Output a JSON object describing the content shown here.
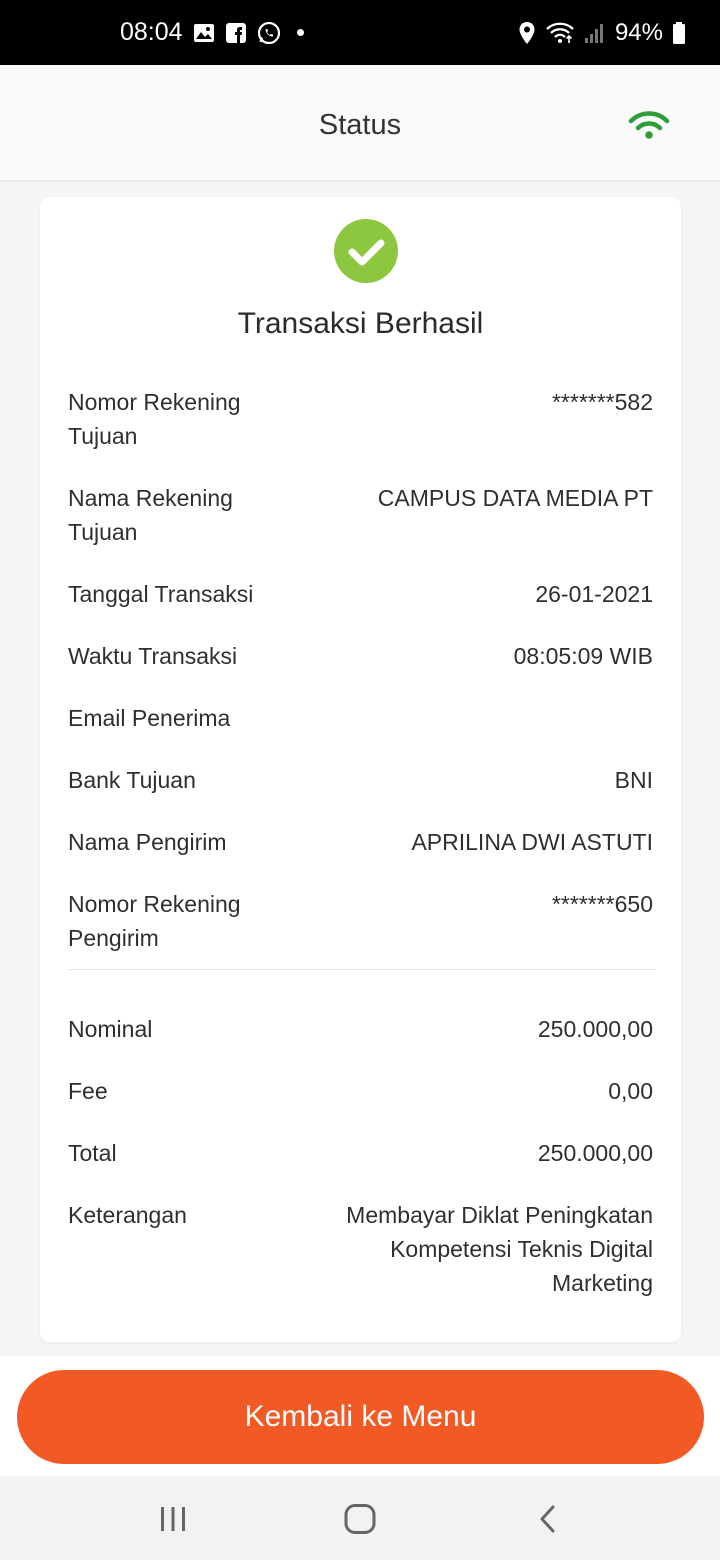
{
  "status_bar": {
    "time": "08:04",
    "battery": "94%",
    "left_icons": [
      "gallery-icon",
      "facebook-icon",
      "whatsapp-icon",
      "notification-dot-icon"
    ],
    "right_icons": [
      "location-icon",
      "wifi-icon",
      "signal-icon",
      "battery-icon"
    ]
  },
  "header": {
    "title": "Status",
    "wifi_icon": "wifi-icon",
    "wifi_color": "#2e9d3a"
  },
  "card": {
    "icon": "check-circle-icon",
    "icon_color": "#8dc63f",
    "title": "Transaksi Berhasil",
    "details": [
      {
        "label": "Nomor Rekening Tujuan",
        "value": "*******582"
      },
      {
        "label": "Nama Rekening Tujuan",
        "value": "CAMPUS DATA MEDIA PT"
      },
      {
        "label": "Tanggal Transaksi",
        "value": "26-01-2021"
      },
      {
        "label": "Waktu Transaksi",
        "value": "08:05:09 WIB"
      },
      {
        "label": "Email Penerima",
        "value": ""
      },
      {
        "label": "Bank Tujuan",
        "value": "BNI"
      },
      {
        "label": "Nama Pengirim",
        "value": "APRILINA DWI ASTUTI"
      },
      {
        "label": "Nomor Rekening Pengirim",
        "value": "*******650"
      }
    ],
    "amounts": [
      {
        "label": "Nominal",
        "value": "250.000,00"
      },
      {
        "label": "Fee",
        "value": "0,00"
      },
      {
        "label": "Total",
        "value": "250.000,00"
      },
      {
        "label": "Keterangan",
        "value": "Membayar Diklat Peningkatan Kompetensi Teknis Digital Marketing"
      }
    ]
  },
  "button": {
    "label": "Kembali ke Menu",
    "color": "#f15a24"
  },
  "nav": {
    "icons": [
      "recent-apps-icon",
      "home-icon",
      "back-icon"
    ]
  }
}
